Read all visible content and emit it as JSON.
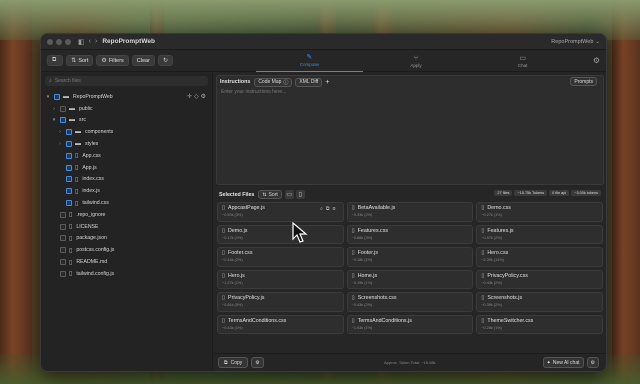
{
  "window": {
    "title": "RepoPromptWeb",
    "workspace_menu": "RepoPromptWeb"
  },
  "toolbar": {
    "sort_label": "Sort",
    "filters_label": "Filters",
    "clear_label": "Clear"
  },
  "modes": [
    {
      "label": "Compose",
      "icon": "pencil-icon",
      "active": true
    },
    {
      "label": "Apply",
      "icon": "merge-icon",
      "active": false
    },
    {
      "label": "Chat",
      "icon": "chat-icon",
      "active": false
    }
  ],
  "sidebar": {
    "search_placeholder": "Search files",
    "tree": [
      {
        "label": "RepoPromptWeb",
        "type": "root",
        "depth": 0,
        "caret": "▾",
        "checked": true
      },
      {
        "label": "public",
        "type": "folder",
        "depth": 1,
        "caret": "›",
        "checked": false
      },
      {
        "label": "src",
        "type": "folder",
        "depth": 1,
        "caret": "▾",
        "checked": true
      },
      {
        "label": "components",
        "type": "folder",
        "depth": 2,
        "caret": "›",
        "checked": true
      },
      {
        "label": "styles",
        "type": "folder",
        "depth": 2,
        "caret": "›",
        "checked": true
      },
      {
        "label": "App.css",
        "type": "file",
        "depth": 2,
        "caret": "",
        "checked": true
      },
      {
        "label": "App.js",
        "type": "file",
        "depth": 2,
        "caret": "",
        "checked": true
      },
      {
        "label": "index.css",
        "type": "file",
        "depth": 2,
        "caret": "",
        "checked": true
      },
      {
        "label": "index.js",
        "type": "file",
        "depth": 2,
        "caret": "",
        "checked": true
      },
      {
        "label": "tailwind.css",
        "type": "file",
        "depth": 2,
        "caret": "",
        "checked": true
      },
      {
        "label": ".repo_ignore",
        "type": "file",
        "depth": 1,
        "caret": "",
        "checked": false
      },
      {
        "label": "LICENSE",
        "type": "file",
        "depth": 1,
        "caret": "",
        "checked": false
      },
      {
        "label": "package.json",
        "type": "file",
        "depth": 1,
        "caret": "",
        "checked": false
      },
      {
        "label": "postcss.config.js",
        "type": "file",
        "depth": 1,
        "caret": "",
        "checked": false
      },
      {
        "label": "README.md",
        "type": "file",
        "depth": 1,
        "caret": "",
        "checked": false
      },
      {
        "label": "tailwind.config.js",
        "type": "file",
        "depth": 1,
        "caret": "",
        "checked": false
      }
    ]
  },
  "instructions": {
    "tab_label": "Instructions",
    "codemap_label": "Code Map",
    "xmldiff_label": "XML Diff",
    "add_label": "+",
    "prompts_label": "Prompts",
    "placeholder": "Enter your instructions here..."
  },
  "selected_files": {
    "title": "Selected Files",
    "sort_label": "Sort",
    "stats": [
      "27 files",
      "~15.75k Tokens",
      "0 file api",
      "~3.00k tokens"
    ],
    "files": [
      {
        "name": "AppcastPage.js",
        "meta": "~0.59k (3%)"
      },
      {
        "name": "BetaAvailable.js",
        "meta": "~0.33k (2%)"
      },
      {
        "name": "Demo.css",
        "meta": "~0.27k (1%)"
      },
      {
        "name": "Demo.js",
        "meta": "~0.17k (1%)"
      },
      {
        "name": "Features.css",
        "meta": "~0.66k (3%)"
      },
      {
        "name": "Features.js",
        "meta": "~0.57k (2%)"
      },
      {
        "name": "Footer.css",
        "meta": "~0.44k (2%)"
      },
      {
        "name": "Footer.js",
        "meta": "~0.18k (1%)"
      },
      {
        "name": "Hero.css",
        "meta": "~2.39k (14%)"
      },
      {
        "name": "Hero.js",
        "meta": "~1.27k (1%)"
      },
      {
        "name": "Home.js",
        "meta": "~0.19k (1%)"
      },
      {
        "name": "PrivacyPolicy.css",
        "meta": "~0.43k (2%)"
      },
      {
        "name": "PrivacyPolicy.js",
        "meta": "~0.81k (5%)"
      },
      {
        "name": "Screenshots.css",
        "meta": "~0.43k (2%)"
      },
      {
        "name": "Screenshots.js",
        "meta": "~0.39k (2%)"
      },
      {
        "name": "TermsAndConditions.css",
        "meta": "~0.43k (1%)"
      },
      {
        "name": "TermsAndConditions.js",
        "meta": "~1.03k (1%)"
      },
      {
        "name": "ThemeSwitcher.css",
        "meta": "~0.28k (1%)"
      }
    ]
  },
  "footer": {
    "copy_label": "Copy",
    "token_total": "Approx. Token Total: ~15.08k",
    "new_chat_label": "New AI chat"
  },
  "colors": {
    "accent": "#3b8eea",
    "window_bg": "#252526"
  }
}
